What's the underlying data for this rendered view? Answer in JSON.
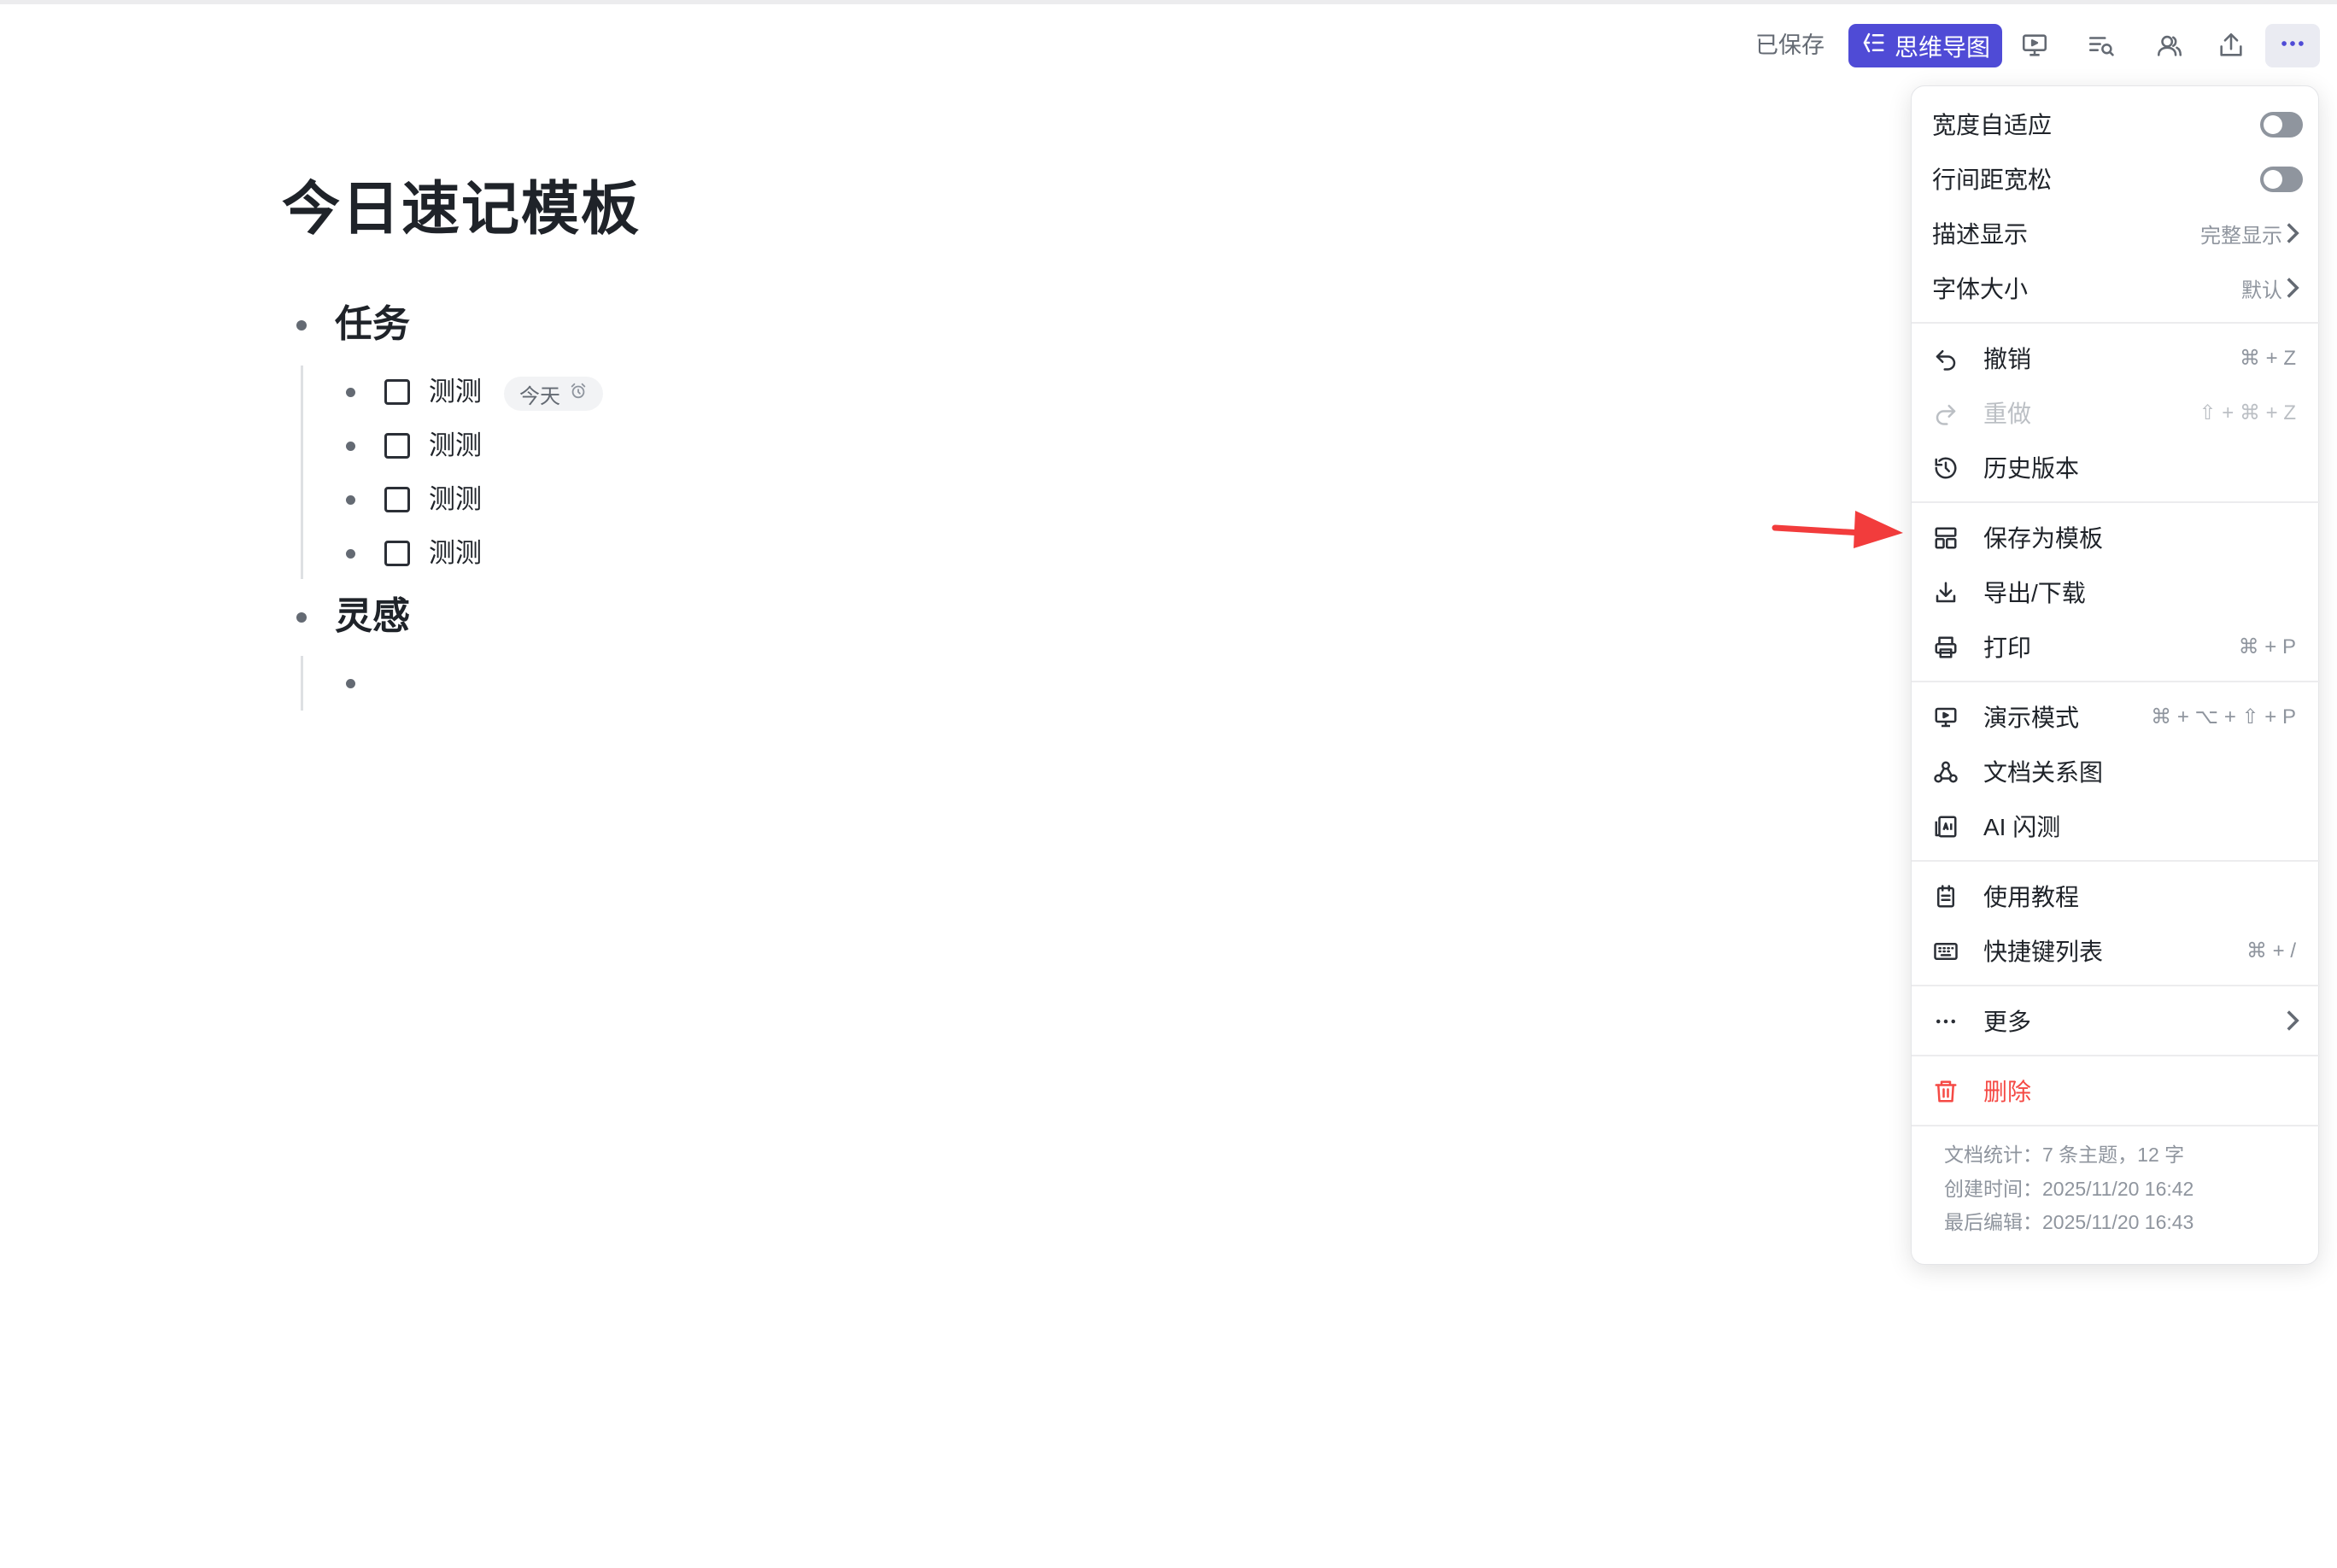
{
  "toolbar": {
    "saved_label": "已保存",
    "mindmap_label": "思维导图",
    "accent": "#4f4bd6",
    "icons": [
      "presentation-icon",
      "outline-search-icon",
      "collaborators-icon",
      "share-icon",
      "more-icon"
    ]
  },
  "document": {
    "title": "今日速记模板",
    "topics": [
      {
        "title": "任务",
        "tasks": [
          {
            "text": "测测",
            "checked": false,
            "due": "今天"
          },
          {
            "text": "测测",
            "checked": false
          },
          {
            "text": "测测",
            "checked": false
          },
          {
            "text": "测测",
            "checked": false
          }
        ]
      },
      {
        "title": "灵感",
        "items": [
          ""
        ]
      }
    ]
  },
  "menu": {
    "width_adaptive": {
      "label": "宽度自适应",
      "on": false
    },
    "line_spacing": {
      "label": "行间距宽松",
      "on": false
    },
    "description_display": {
      "label": "描述显示",
      "value": "完整显示"
    },
    "font_size": {
      "label": "字体大小",
      "value": "默认"
    },
    "undo": {
      "label": "撤销",
      "shortcut": "⌘ + Z",
      "icon": "undo-icon"
    },
    "redo": {
      "label": "重做",
      "shortcut": "⇧ + ⌘ + Z",
      "icon": "redo-icon",
      "disabled": true
    },
    "history": {
      "label": "历史版本",
      "icon": "history-icon"
    },
    "save_template": {
      "label": "保存为模板",
      "icon": "template-icon"
    },
    "export": {
      "label": "导出/下载",
      "icon": "download-icon"
    },
    "print": {
      "label": "打印",
      "shortcut": "⌘ + P",
      "icon": "print-icon"
    },
    "present": {
      "label": "演示模式",
      "shortcut": "⌘ + ⌥ + ⇧ + P",
      "icon": "presentation-icon"
    },
    "relation_graph": {
      "label": "文档关系图",
      "icon": "graph-icon"
    },
    "ai_flash": {
      "label": "AI 闪测",
      "icon": "ai-icon"
    },
    "tutorial": {
      "label": "使用教程",
      "icon": "clipboard-icon"
    },
    "shortcuts": {
      "label": "快捷键列表",
      "shortcut": "⌘ + /",
      "icon": "keyboard-icon"
    },
    "more": {
      "label": "更多",
      "icon": "dots-icon"
    },
    "delete": {
      "label": "删除",
      "icon": "trash-icon",
      "color": "#f54a45"
    },
    "stats": {
      "doc_stats": "文档统计：7 条主题，12 字",
      "created": "创建时间：2025/11/20 16:42",
      "last_edit": "最后编辑：2025/11/20 16:43"
    }
  },
  "annotation": {
    "arrow_color": "#f23c3c"
  }
}
